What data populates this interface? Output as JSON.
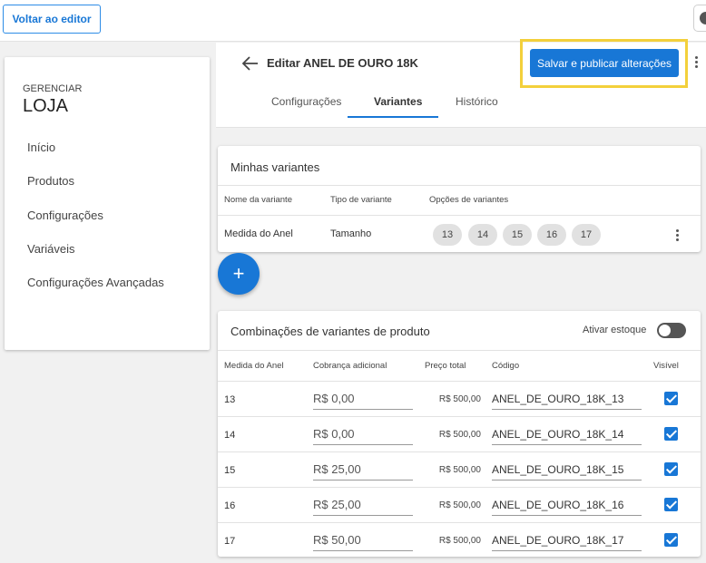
{
  "topbar": {
    "back_label": "Voltar ao editor"
  },
  "sidebar": {
    "kicker": "GERENCIAR",
    "title": "LOJA",
    "items": [
      "Início",
      "Produtos",
      "Configurações",
      "Variáveis",
      "Configurações Avançadas"
    ]
  },
  "header": {
    "product_title": "Editar ANEL DE OURO 18K",
    "publish_label": "Salvar e publicar alterações",
    "tabs": [
      "Configurações",
      "Variantes",
      "Histórico"
    ],
    "active_tab": "Variantes"
  },
  "variants": {
    "title": "Minhas variantes",
    "columns": [
      "Nome da variante",
      "Tipo de variante",
      "Opções de variantes"
    ],
    "rows": [
      {
        "name": "Medida do Anel",
        "type": "Tamanho",
        "options": [
          "13",
          "14",
          "15",
          "16",
          "17"
        ]
      }
    ]
  },
  "combinations": {
    "title": "Combinações de variantes de produto",
    "stock_label": "Ativar estoque",
    "stock_enabled": false,
    "columns": [
      "Medida do Anel",
      "Cobrança adicional",
      "Preço total",
      "Código",
      "Visível"
    ],
    "rows": [
      {
        "medida": "13",
        "adicional": "R$ 0,00",
        "total": "R$ 500,00",
        "codigo": "ANEL_DE_OURO_18K_13",
        "visivel": true
      },
      {
        "medida": "14",
        "adicional": "R$ 0,00",
        "total": "R$ 500,00",
        "codigo": "ANEL_DE_OURO_18K_14",
        "visivel": true
      },
      {
        "medida": "15",
        "adicional": "R$ 25,00",
        "total": "R$ 500,00",
        "codigo": "ANEL_DE_OURO_18K_15",
        "visivel": true
      },
      {
        "medida": "16",
        "adicional": "R$ 25,00",
        "total": "R$ 500,00",
        "codigo": "ANEL_DE_OURO_18K_16",
        "visivel": true
      },
      {
        "medida": "17",
        "adicional": "R$ 50,00",
        "total": "R$ 500,00",
        "codigo": "ANEL_DE_OURO_18K_17",
        "visivel": true
      }
    ]
  },
  "colors": {
    "accent": "#1877d6",
    "highlight": "#f3d03b"
  }
}
